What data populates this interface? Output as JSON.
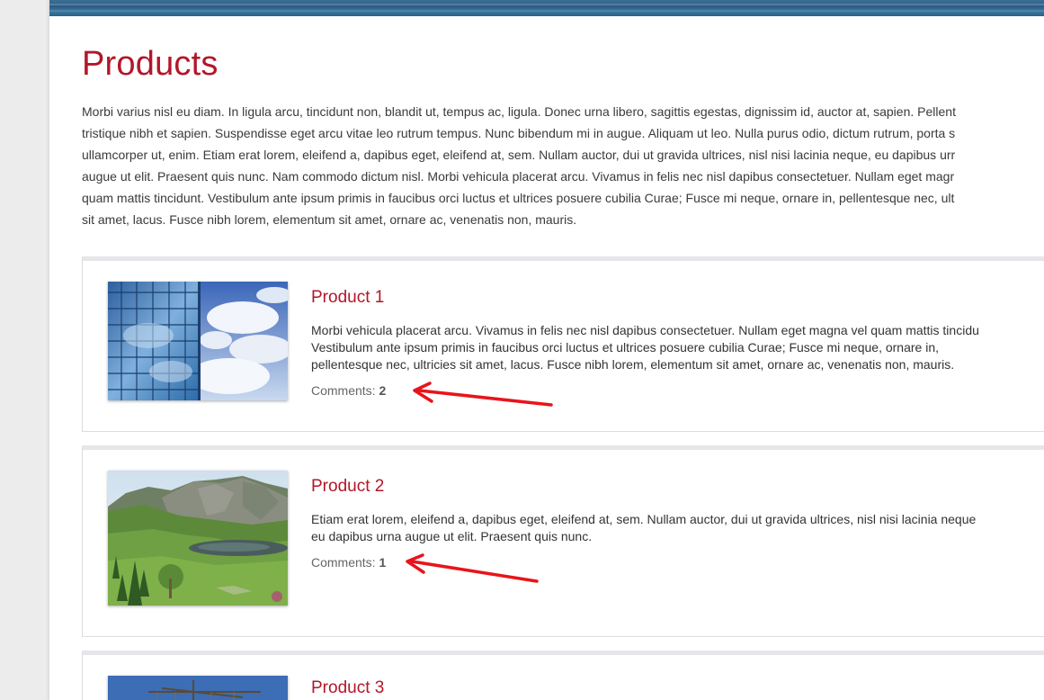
{
  "page": {
    "title": "Products",
    "intro_lines": [
      "Morbi varius nisl eu diam. In ligula arcu, tincidunt non, blandit ut, tempus ac, ligula. Donec urna libero, sagittis egestas, dignissim id, auctor at, sapien. Pellent",
      "tristique nibh et sapien. Suspendisse eget arcu vitae leo rutrum tempus. Nunc bibendum mi in augue. Aliquam ut leo. Nulla purus odio, dictum rutrum, porta s",
      "ullamcorper ut, enim. Etiam erat lorem, eleifend a, dapibus eget, eleifend at, sem. Nullam auctor, dui ut gravida ultrices, nisl nisi lacinia neque, eu dapibus urr",
      "augue ut elit. Praesent quis nunc. Nam commodo dictum nisl. Morbi vehicula placerat arcu. Vivamus in felis nec nisl dapibus consectetuer. Nullam eget magr",
      "quam mattis tincidunt. Vestibulum ante ipsum primis in faucibus orci luctus et ultrices posuere cubilia Curae; Fusce mi neque, ornare in, pellentesque nec, ult",
      "sit amet, lacus. Fusce nibh lorem, elementum sit amet, ornare ac, venenatis non, mauris."
    ]
  },
  "products": [
    {
      "title": "Product 1",
      "desc_lines": [
        "Morbi vehicula placerat arcu. Vivamus in felis nec nisl dapibus consectetuer. Nullam eget magna vel quam mattis tincidu",
        "Vestibulum ante ipsum primis in faucibus orci luctus et ultrices posuere cubilia Curae; Fusce mi neque, ornare in,",
        "pellentesque nec, ultricies sit amet, lacus. Fusce nibh lorem, elementum sit amet, ornare ac, venenatis non, mauris."
      ],
      "comments_label": "Comments:",
      "comments_count": "2",
      "image": "glass-building-sky-photo"
    },
    {
      "title": "Product 2",
      "desc_lines": [
        "Etiam erat lorem, eleifend a, dapibus eget, eleifend at, sem. Nullam auctor, dui ut gravida ultrices, nisl nisi lacinia neque",
        "eu dapibus urna augue ut elit. Praesent quis nunc."
      ],
      "comments_label": "Comments:",
      "comments_count": "1",
      "image": "mountain-valley-lake-photo"
    },
    {
      "title": "Product 3",
      "image": "ship-mast-sky-photo"
    }
  ],
  "annotations": {
    "arrow_color": "#e8141b"
  },
  "colors": {
    "accent": "#b3162a",
    "page_bg": "#ececec"
  }
}
